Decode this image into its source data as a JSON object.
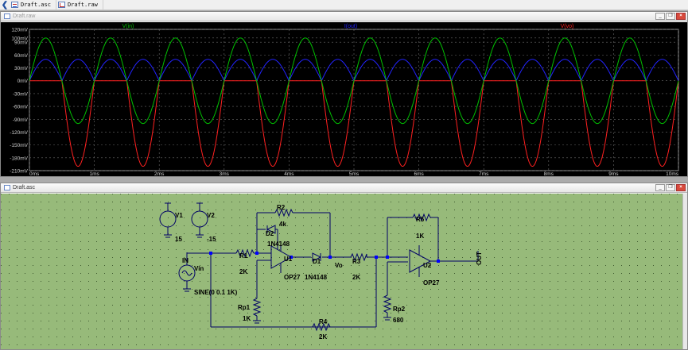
{
  "tabs": [
    {
      "label": "Draft.asc",
      "icon": "schematic-file-icon"
    },
    {
      "label": "Draft.raw",
      "icon": "waveform-file-icon"
    }
  ],
  "waveform_window": {
    "title": "Draft.raw",
    "traces": [
      {
        "name": "V(in)",
        "color": "#00c000"
      },
      {
        "name": "I(out)",
        "color": "#2323ff"
      },
      {
        "name": "V(vo)",
        "color": "#ff2020"
      }
    ]
  },
  "schematic_window": {
    "title": "Draft.asc",
    "background": "#97ba7a",
    "labels": {
      "v1": "V1",
      "v1_val": "15",
      "v2": "V2",
      "v2_val": "-15",
      "r2": "R2",
      "r2_val": "4k",
      "d2": "D2",
      "d2_val": "1N4148",
      "r1": "R1",
      "r1_val": "2K",
      "u1": "U1",
      "u1_model": "OP27",
      "d1": "D1",
      "d1_val": "1N4148",
      "vo": "Vo",
      "r3": "R3",
      "r3_val": "2K",
      "r5": "R5",
      "r5_val": "1K",
      "u2": "U2",
      "u2_model": "OP27",
      "out": "OUT",
      "in": "IN",
      "vin": "Vin",
      "vin_val": "SINE(0 0.1 1K)",
      "rp1": "Rp1",
      "rp1_val": "1K",
      "rp2": "Rp2",
      "rp2_val": "680",
      "r4": "R4",
      "r4_val": "2K"
    }
  },
  "window_buttons": {
    "minimize": "_",
    "restore": "❐",
    "close": "×"
  },
  "chart_data": {
    "type": "line",
    "xlabel": "",
    "ylabel": "",
    "xlim": [
      0,
      10
    ],
    "ylim": [
      -210,
      120
    ],
    "x_tick_labels": [
      "0ms",
      "1ms",
      "2ms",
      "3ms",
      "4ms",
      "5ms",
      "6ms",
      "7ms",
      "8ms",
      "9ms",
      "10ms"
    ],
    "y_ticks": [
      120,
      100,
      90,
      60,
      30,
      0,
      -30,
      -60,
      -90,
      -120,
      -150,
      -180,
      -210
    ],
    "y_tick_labels": [
      "120mV",
      "100mV",
      "90mV",
      "60mV",
      "30mV",
      "0mV",
      "-30mV",
      "-60mV",
      "-90mV",
      "-120mV",
      "-150mV",
      "-180mV",
      "-210mV"
    ],
    "grid": true,
    "series": [
      {
        "name": "V(in)",
        "kind": "sine",
        "frequency_khz": 1,
        "amplitude_mv": 100,
        "offset_mv": 0
      },
      {
        "name": "I(out)",
        "kind": "abs-sine",
        "frequency_khz": 1,
        "amplitude_mv": 50,
        "offset_mv": 0
      },
      {
        "name": "V(vo)",
        "kind": "half-wave-negative",
        "frequency_khz": 1,
        "amplitude_mv": 200,
        "offset_mv": 0
      }
    ]
  }
}
